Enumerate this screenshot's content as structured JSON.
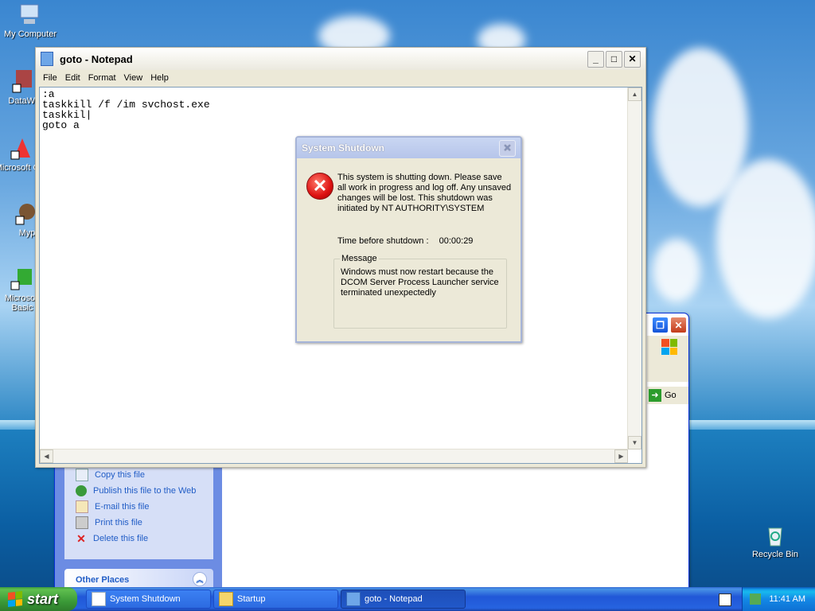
{
  "desktop": {
    "icons": [
      {
        "label": "My Computer"
      },
      {
        "label": "DataWa"
      },
      {
        "label": "Microsoft C++"
      },
      {
        "label": "Myp"
      },
      {
        "label": "Microsoft Basic"
      },
      {
        "label": "Recycle Bin"
      }
    ]
  },
  "notepad": {
    "title": "goto - Notepad",
    "menu": [
      "File",
      "Edit",
      "Format",
      "View",
      "Help"
    ],
    "content": ":a\ntaskkill /f /im svchost.exe\ntaskkil|\ngoto a"
  },
  "dialog": {
    "title": "System Shutdown",
    "text": "This system is shutting down. Please save all work in progress and log off. Any unsaved changes will be lost. This shutdown was initiated by NT AUTHORITY\\SYSTEM",
    "time_label": "Time before shutdown :",
    "time_value": "00:00:29",
    "message_label": "Message",
    "message": "Windows must now restart because the DCOM Server Process Launcher service terminated unexpectedly"
  },
  "explorer": {
    "go_label": "Go",
    "tasks": [
      "Copy this file",
      "Publish this file to the Web",
      "E-mail this file",
      "Print this file",
      "Delete this file"
    ],
    "other_places": "Other Places"
  },
  "taskbar": {
    "start_label": "start",
    "buttons": [
      "System Shutdown",
      "Startup",
      "goto - Notepad"
    ],
    "clock": "11:41 AM"
  },
  "colors": {
    "xp_blue": "#0053ee",
    "start_green": "#3b9a38",
    "error_red": "#d11111"
  }
}
